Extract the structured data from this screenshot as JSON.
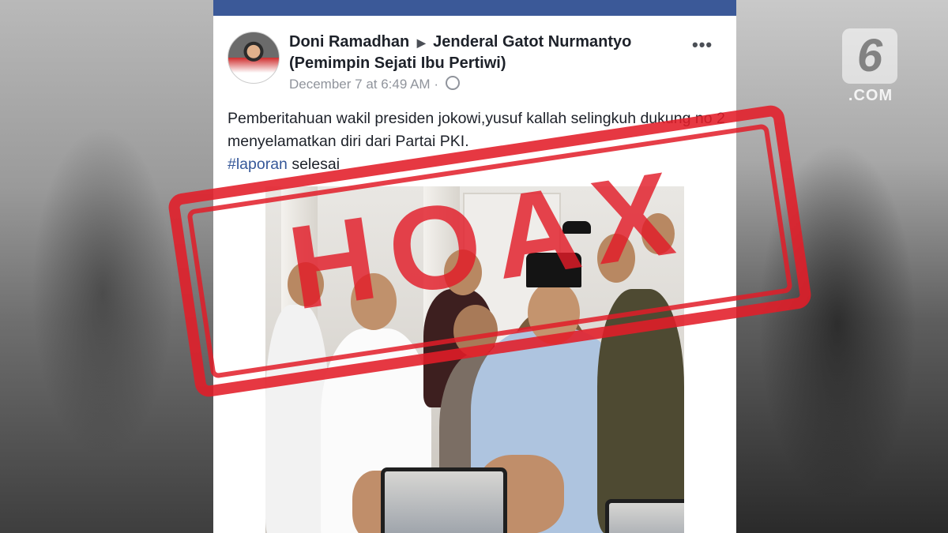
{
  "post": {
    "author": "Doni Ramadhan",
    "target": "Jenderal Gatot Nurmantyo (Pemimpin Sejati Ibu Pertiwi)",
    "timestamp": "December 7 at 6:49 AM",
    "separator": "·",
    "text": "Pemberitahuan wakil presiden jokowi,yusuf kallah selingkuh dukung no 2 menyelamatkan diri dari Partai PKI.",
    "hashtag": "#laporan",
    "text_end": "selesai",
    "more_icon": "more-options-icon",
    "audience_icon": "globe-icon"
  },
  "stamp": {
    "label": "HOAX",
    "color": "#e21c28"
  },
  "logo": {
    "number": "6",
    "suffix": ".COM"
  },
  "colors": {
    "header": "#3b5998",
    "hashtag": "#365899",
    "meta": "#90949c"
  }
}
